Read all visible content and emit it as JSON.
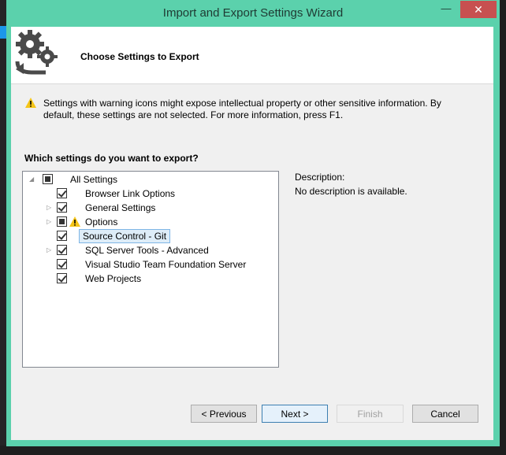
{
  "window": {
    "title": "Import and Export Settings Wizard",
    "minimize_glyph": "—",
    "close_glyph": "✕"
  },
  "header": {
    "icon": "gears-arrow-icon",
    "title": "Choose Settings to Export"
  },
  "warning": {
    "icon": "warning-icon",
    "text": "Settings with warning icons might expose intellectual property or other sensitive information. By default, these settings are not selected. For more information, press F1."
  },
  "question": "Which settings do you want to export?",
  "tree": {
    "root": {
      "label": "All Settings",
      "state": "indeterminate",
      "expanded": true
    },
    "items": [
      {
        "label": "Browser Link Options",
        "state": "checked",
        "expandable": false,
        "warning": false,
        "selected": false
      },
      {
        "label": "General Settings",
        "state": "checked",
        "expandable": true,
        "warning": false,
        "selected": false
      },
      {
        "label": "Options",
        "state": "indeterminate",
        "expandable": true,
        "warning": true,
        "selected": false
      },
      {
        "label": "Source Control - Git",
        "state": "checked",
        "expandable": false,
        "warning": false,
        "selected": true
      },
      {
        "label": "SQL Server Tools - Advanced",
        "state": "checked",
        "expandable": true,
        "warning": false,
        "selected": false
      },
      {
        "label": "Visual Studio Team Foundation Server",
        "state": "checked",
        "expandable": false,
        "warning": false,
        "selected": false
      },
      {
        "label": "Web Projects",
        "state": "checked",
        "expandable": false,
        "warning": false,
        "selected": false
      }
    ]
  },
  "description": {
    "label": "Description:",
    "text": "No description is available."
  },
  "buttons": {
    "previous": "< Previous",
    "next": "Next >",
    "finish": "Finish",
    "cancel": "Cancel"
  },
  "colors": {
    "frame": "#5bd1ac",
    "close": "#c75050",
    "warning": "#f5c518"
  }
}
